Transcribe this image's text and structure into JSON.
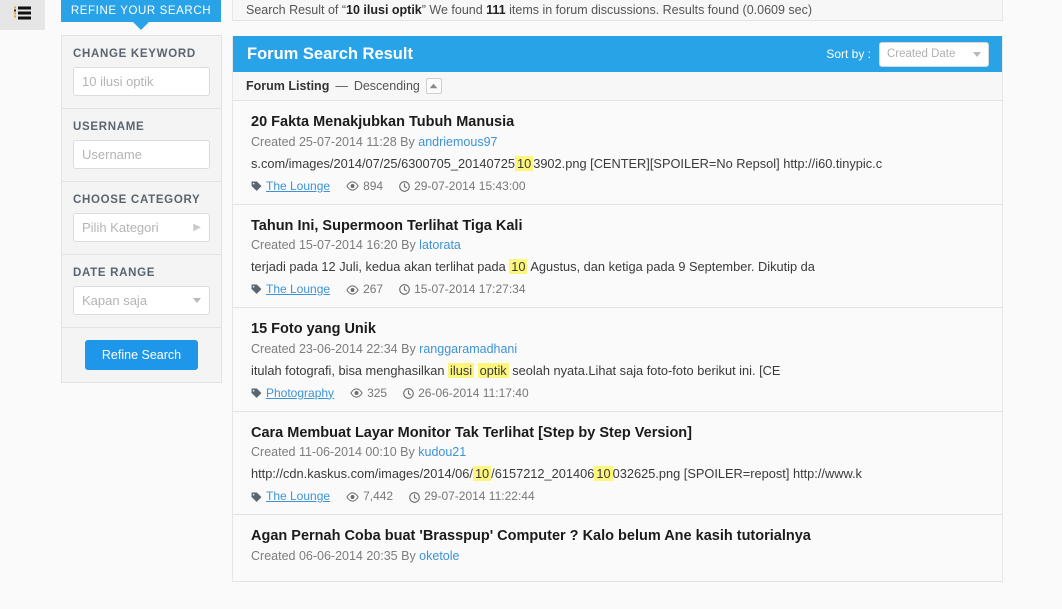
{
  "topbar": {
    "prefix": "Search Result of “",
    "query": "10 ilusi optik",
    "middle": "” We found ",
    "count": "111",
    "suffix": " items in forum discussions. Results found (0.0609 sec)"
  },
  "rail": {
    "icon": "list-icon"
  },
  "refine_tab": {
    "label": "REFINE YOUR SEARCH"
  },
  "sidebar": {
    "filters": [
      {
        "label": "CHANGE KEYWORD",
        "value": "10 ilusi optik",
        "placeholder": "10 ilusi optik",
        "type": "text"
      },
      {
        "label": "USERNAME",
        "value": "",
        "placeholder": "Username",
        "type": "text"
      },
      {
        "label": "CHOOSE CATEGORY",
        "value": "Pilih Kategori",
        "placeholder": "Pilih Kategori",
        "type": "chevron"
      },
      {
        "label": "DATE RANGE",
        "value": "Kapan saja",
        "placeholder": "Kapan saja",
        "type": "caret"
      }
    ],
    "refine_button": "Refine Search"
  },
  "results": {
    "title": "Forum Search Result",
    "sort_by_label": "Sort by :",
    "sort_value": "Created Date",
    "listing_label": "Forum Listing",
    "listing_dash": "—",
    "listing_order": "Descending",
    "sort_toggle_icon": "caret-up-icon",
    "items": [
      {
        "title": "20 Fakta Menakjubkan Tubuh Manusia",
        "created_prefix": "Created 25-07-2014 11:28 By ",
        "author": "andriemous97",
        "snippet_parts": [
          {
            "t": "s.com/images/2014/07/25/6300705_20140725",
            "h": false
          },
          {
            "t": "10",
            "h": true
          },
          {
            "t": "3902.png [CENTER][SPOILER=No Repsol] http://i60.tinypic.c",
            "h": false
          }
        ],
        "category": "The Lounge",
        "views": "894",
        "date": "29-07-2014 15:43:00"
      },
      {
        "title": "Tahun Ini, Supermoon Terlihat Tiga Kali",
        "created_prefix": "Created 15-07-2014 16:20 By ",
        "author": "latorata",
        "snippet_parts": [
          {
            "t": "terjadi pada 12 Juli, kedua akan terlihat pada ",
            "h": false
          },
          {
            "t": "10",
            "h": true
          },
          {
            "t": " Agustus, dan ketiga pada 9 September. Dikutip da",
            "h": false
          }
        ],
        "category": "The Lounge",
        "views": "267",
        "date": "15-07-2014 17:27:34"
      },
      {
        "title": "15 Foto yang Unik",
        "created_prefix": "Created 23-06-2014 22:34 By ",
        "author": "ranggaramadhani",
        "snippet_parts": [
          {
            "t": "itulah fotografi, bisa menghasilkan ",
            "h": false
          },
          {
            "t": "ilusi",
            "h": true
          },
          {
            "t": " ",
            "h": false
          },
          {
            "t": "optik",
            "h": true
          },
          {
            "t": " seolah nyata.Lihat saja foto-foto berikut ini. [CE",
            "h": false
          }
        ],
        "category": "Photography",
        "views": "325",
        "date": "26-06-2014 11:17:40"
      },
      {
        "title": "Cara Membuat Layar Monitor Tak Terlihat [Step by Step Version]",
        "created_prefix": "Created 11-06-2014 00:10 By ",
        "author": "kudou21",
        "snippet_parts": [
          {
            "t": "http://cdn.kaskus.com/images/2014/06/",
            "h": false
          },
          {
            "t": "10",
            "h": true
          },
          {
            "t": "/6157212_201406",
            "h": false
          },
          {
            "t": "10",
            "h": true
          },
          {
            "t": "032625.png [SPOILER=repost] http://www.k",
            "h": false
          }
        ],
        "category": "The Lounge",
        "views": "7,442",
        "date": "29-07-2014 11:22:44"
      },
      {
        "title": "Agan Pernah Coba buat 'Brasspup' Computer ? Kalo belum Ane kasih tutorialnya",
        "created_prefix": "Created 06-06-2014 20:35 By ",
        "author": "oketole",
        "snippet_parts": [],
        "category": "",
        "views": "",
        "date": ""
      }
    ]
  },
  "colors": {
    "accent": "#29a3e8",
    "button": "#1e97ea",
    "link": "#3c93d6",
    "highlight": "#fcf67c"
  }
}
